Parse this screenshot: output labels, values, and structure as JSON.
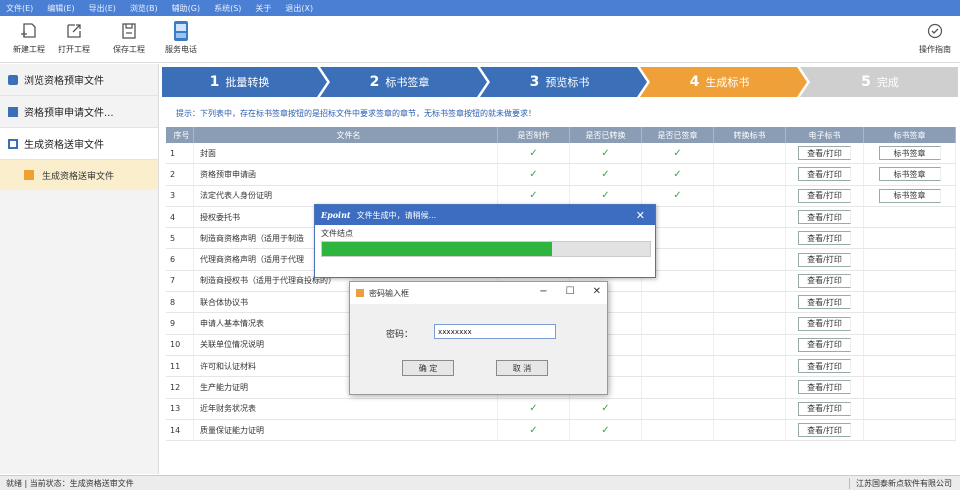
{
  "menu": [
    "文件(E)",
    "编辑(E)",
    "导出(E)",
    "浏览(B)",
    "辅助(G)",
    "系统(S)",
    "关于",
    "退出(X)"
  ],
  "toolbar": {
    "new": "新建工程",
    "open": "打开工程",
    "save": "保存工程",
    "phone": "服务电话",
    "guide": "操作指南"
  },
  "sidebar": {
    "items": [
      "浏览资格预审文件",
      "资格预审申请文件...",
      "生成资格送审文件"
    ],
    "sub": "生成资格送审文件"
  },
  "steps": [
    {
      "num": "1",
      "label": "批量转换",
      "color": "#3b6fb8"
    },
    {
      "num": "2",
      "label": "标书签章",
      "color": "#3b6fb8"
    },
    {
      "num": "3",
      "label": "预览标书",
      "color": "#3b6fb8"
    },
    {
      "num": "4",
      "label": "生成标书",
      "color": "#f0a038"
    },
    {
      "num": "5",
      "label": "完成",
      "color": "#cfcfcf"
    }
  ],
  "tip": "提示：下列表中，存在标书签章按钮的是招标文件中要求签章的章节，无标书签章按钮的就未做要求！",
  "table": {
    "headers": [
      "序号",
      "文件名",
      "是否制作",
      "是否已转换",
      "是否已签章",
      "转换标书",
      "电子标书",
      "标书签章"
    ],
    "view_btn": "查看/打印",
    "sign_btn": "标书签章",
    "rows": [
      {
        "no": "1",
        "name": "封面",
        "made": "✓",
        "conv": "✓",
        "signed": "✓",
        "sign": true
      },
      {
        "no": "2",
        "name": "资格预审申请函",
        "made": "✓",
        "conv": "✓",
        "signed": "✓",
        "sign": true
      },
      {
        "no": "3",
        "name": "法定代表人身份证明",
        "made": "✓",
        "conv": "✓",
        "signed": "✓",
        "sign": true
      },
      {
        "no": "4",
        "name": "授权委托书",
        "made": "",
        "conv": "",
        "signed": "",
        "sign": false
      },
      {
        "no": "5",
        "name": "制造商资格声明（适用于制造",
        "made": "",
        "conv": "",
        "signed": "",
        "sign": false
      },
      {
        "no": "6",
        "name": "代理商资格声明（适用于代理",
        "made": "",
        "conv": "",
        "signed": "",
        "sign": false
      },
      {
        "no": "7",
        "name": "制造商授权书（适用于代理商投标的）",
        "made": "",
        "conv": "",
        "signed": "",
        "sign": false
      },
      {
        "no": "8",
        "name": "联合体协议书",
        "made": "",
        "conv": "",
        "signed": "",
        "sign": false
      },
      {
        "no": "9",
        "name": "申请人基本情况表",
        "made": "",
        "conv": "",
        "signed": "",
        "sign": false
      },
      {
        "no": "10",
        "name": "关联单位情况说明",
        "made": "",
        "conv": "",
        "signed": "",
        "sign": false
      },
      {
        "no": "11",
        "name": "许可和认证材料",
        "made": "",
        "conv": "",
        "signed": "",
        "sign": false
      },
      {
        "no": "12",
        "name": "生产能力证明",
        "made": "",
        "conv": "",
        "signed": "",
        "sign": false
      },
      {
        "no": "13",
        "name": "近年财务状况表",
        "made": "✓",
        "conv": "✓",
        "signed": "",
        "sign": false
      },
      {
        "no": "14",
        "name": "质量保证能力证明",
        "made": "✓",
        "conv": "✓",
        "signed": "",
        "sign": false
      }
    ]
  },
  "progress_dialog": {
    "logo": "Epoint",
    "title": "文件生成中，请稍候...",
    "label": "文件结点",
    "progress": 0.7
  },
  "password_dialog": {
    "title": "密码输入框",
    "label": "密码：",
    "value": "xxxxxxxx",
    "ok": "确 定",
    "cancel": "取 消"
  },
  "status": {
    "left": "就绪 | 当前状态：生成资格送审文件",
    "right": "江苏国泰新点软件有限公司"
  }
}
